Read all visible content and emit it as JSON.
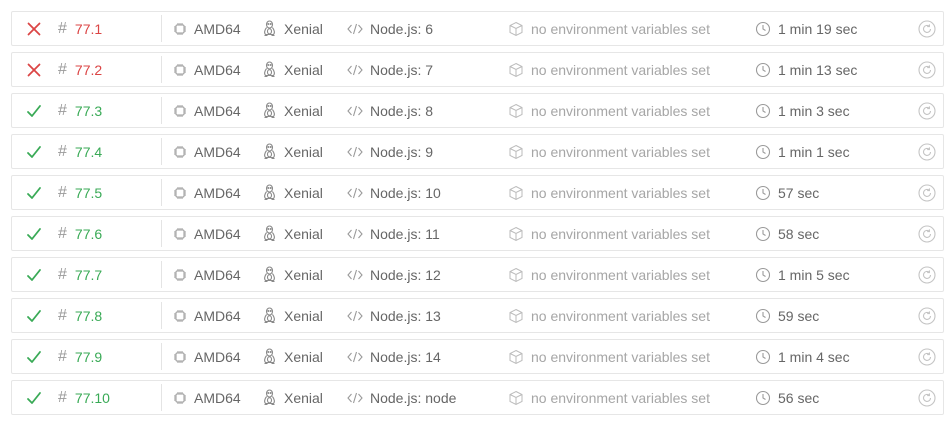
{
  "colors": {
    "failed": "#db4545",
    "passed": "#39aa56",
    "icon": "#9a9a9a"
  },
  "icons": {
    "failed": "x-icon",
    "passed": "check-icon",
    "number": "hash-icon",
    "arch": "cpu-chip-icon",
    "os": "linux-penguin-icon",
    "language": "code-brackets-icon",
    "env": "package-box-icon",
    "duration": "clock-icon",
    "restart": "restart-icon"
  },
  "jobs": [
    {
      "state": "failed",
      "number": "77.1",
      "arch": "AMD64",
      "os": "Xenial",
      "language": "Node.js: 6",
      "env": "no environment variables set",
      "duration": "1 min 19 sec"
    },
    {
      "state": "failed",
      "number": "77.2",
      "arch": "AMD64",
      "os": "Xenial",
      "language": "Node.js: 7",
      "env": "no environment variables set",
      "duration": "1 min 13 sec"
    },
    {
      "state": "passed",
      "number": "77.3",
      "arch": "AMD64",
      "os": "Xenial",
      "language": "Node.js: 8",
      "env": "no environment variables set",
      "duration": "1 min 3 sec"
    },
    {
      "state": "passed",
      "number": "77.4",
      "arch": "AMD64",
      "os": "Xenial",
      "language": "Node.js: 9",
      "env": "no environment variables set",
      "duration": "1 min 1 sec"
    },
    {
      "state": "passed",
      "number": "77.5",
      "arch": "AMD64",
      "os": "Xenial",
      "language": "Node.js: 10",
      "env": "no environment variables set",
      "duration": "57 sec"
    },
    {
      "state": "passed",
      "number": "77.6",
      "arch": "AMD64",
      "os": "Xenial",
      "language": "Node.js: 11",
      "env": "no environment variables set",
      "duration": "58 sec"
    },
    {
      "state": "passed",
      "number": "77.7",
      "arch": "AMD64",
      "os": "Xenial",
      "language": "Node.js: 12",
      "env": "no environment variables set",
      "duration": "1 min 5 sec"
    },
    {
      "state": "passed",
      "number": "77.8",
      "arch": "AMD64",
      "os": "Xenial",
      "language": "Node.js: 13",
      "env": "no environment variables set",
      "duration": "59 sec"
    },
    {
      "state": "passed",
      "number": "77.9",
      "arch": "AMD64",
      "os": "Xenial",
      "language": "Node.js: 14",
      "env": "no environment variables set",
      "duration": "1 min 4 sec"
    },
    {
      "state": "passed",
      "number": "77.10",
      "arch": "AMD64",
      "os": "Xenial",
      "language": "Node.js: node",
      "env": "no environment variables set",
      "duration": "56 sec"
    }
  ]
}
